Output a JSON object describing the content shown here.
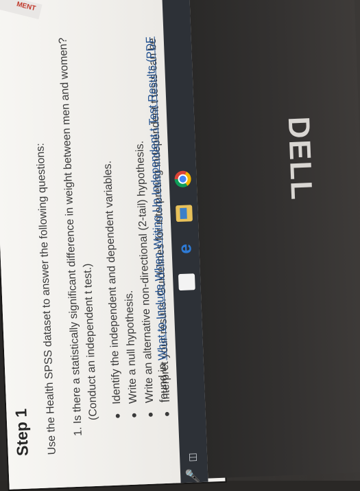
{
  "sticker": {
    "text": "MENT"
  },
  "content": {
    "step_title": "Step 1",
    "intro": "Use the Health SPSS dataset to answer the following questions:",
    "question": {
      "number_text": "1. Is there a statistically significant difference in weight between men and women?",
      "line2": "(Conduct an independent t test.)"
    },
    "bullets": [
      "Identify the independent and dependent variables.",
      "Write a null hypothesis.",
      "Write an alternative non-directional (2-tail) hypothesis.",
      "Interpret your results. Guidelines for interpreting independent t tests can be"
    ],
    "continuation_prefix": "found in ",
    "link_text": "What to Include When Writing Up Independent t Test Results (PDF"
  },
  "taskbar": {
    "icons": [
      "microphone-icon",
      "task-view-icon",
      "store-icon",
      "edge-icon",
      "file-explorer-icon",
      "chrome-icon"
    ]
  },
  "brand": {
    "logo_text": "DELL"
  }
}
